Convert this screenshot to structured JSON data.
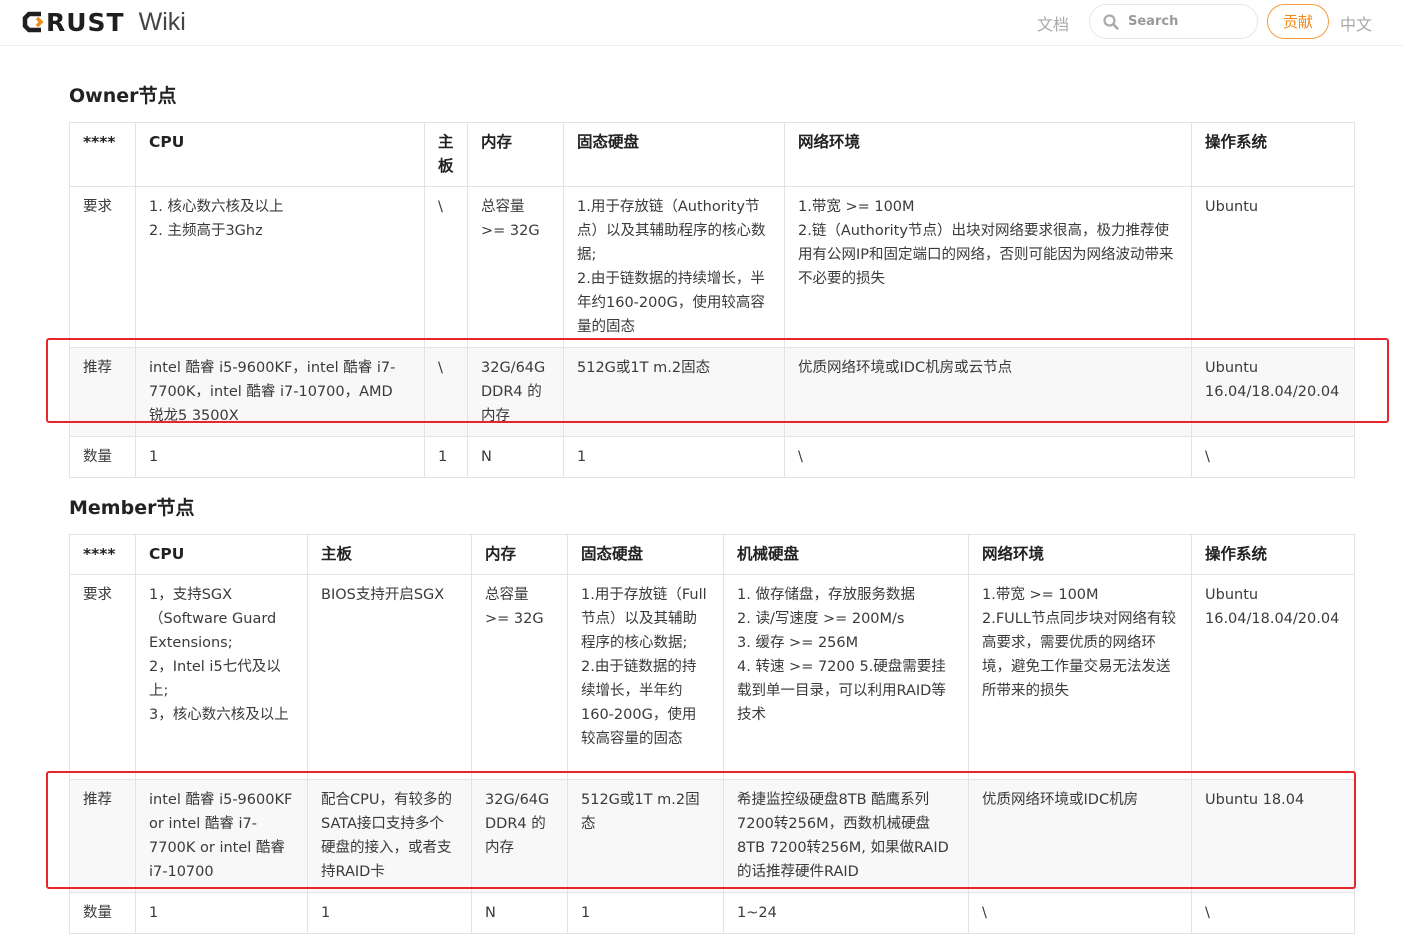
{
  "header": {
    "logo_text": "RUST",
    "logo_suffix": "Wiki",
    "nav_docs": "文档",
    "search_placeholder": "Search",
    "contribute_label": "贡献",
    "language": "中文"
  },
  "owner": {
    "title": "Owner节点",
    "headers": [
      "****",
      "CPU",
      "主板",
      "内存",
      "固态硬盘",
      "网络环境",
      "操作系统"
    ],
    "rows": [
      {
        "label": "要求",
        "cells": [
          "1. 核心数六核及以上\n2. 主频高于3Ghz",
          "\\",
          "总容量 >= 32G",
          "1.用于存放链（Authority节点）以及其辅助程序的核心数据;\n2.由于链数据的持续增长，半年约160-200G，使用较高容量的固态",
          "1.带宽 >= 100M\n2.链（Authority节点）出块对网络要求很高，极力推荐使用有公网IP和固定端口的网络，否则可能因为网络波动带来不必要的损失",
          "Ubuntu"
        ]
      },
      {
        "label": "推荐",
        "cells": [
          "intel 酷睿 i5-9600KF，intel 酷睿 i7-7700K，intel 酷睿 i7-10700，AMD 锐龙5 3500X",
          "\\",
          "32G/64G DDR4 的内存",
          "512G或1T m.2固态",
          "优质网络环境或IDC机房或云节点",
          "Ubuntu 16.04/18.04/20.04"
        ]
      },
      {
        "label": "数量",
        "cells": [
          "1",
          "1",
          "N",
          "1",
          "\\",
          "\\"
        ]
      }
    ]
  },
  "member": {
    "title": "Member节点",
    "headers": [
      "****",
      "CPU",
      "主板",
      "内存",
      "固态硬盘",
      "机械硬盘",
      "网络环境",
      "操作系统"
    ],
    "rows": [
      {
        "label": "要求",
        "cells": [
          "1，支持SGX（Software Guard Extensions;\n2，Intel i5七代及以上;\n3，核心数六核及以上",
          "BIOS支持开启SGX",
          "总容量 >= 32G",
          "1.用于存放链（Full节点）以及其辅助程序的核心数据;\n2.由于链数据的持续增长，半年约160-200G，使用较高容量的固态",
          "1. 做存储盘，存放服务数据\n2. 读/写速度 >= 200M/s\n3. 缓存 >= 256M\n4. 转速 >= 7200 5.硬盘需要挂载到单一目录，可以利用RAID等技术",
          "1.带宽 >= 100M\n2.FULL节点同步块对网络有较高要求，需要优质的网络环境，避免工作量交易无法发送所带来的损失",
          "Ubuntu 16.04/18.04/20.04"
        ]
      },
      {
        "label": "推荐",
        "cells": [
          "intel 酷睿 i5-9600KF or intel 酷睿 i7-7700K or intel 酷睿 i7-10700",
          "配合CPU，有较多的SATA接口支持多个硬盘的接入，或者支持RAID卡",
          "32G/64G DDR4 的内存",
          "512G或1T m.2固态",
          "希捷监控级硬盘8TB 酷鹰系列7200转256M，西数机械硬盘8TB 7200转256M, 如果做RAID的话推荐硬件RAID",
          "优质网络环境或IDC机房",
          "Ubuntu 18.04"
        ]
      },
      {
        "label": "数量",
        "cells": [
          "1",
          "1",
          "N",
          "1",
          "1~24",
          "\\",
          "\\"
        ]
      }
    ]
  },
  "colors": {
    "accent": "#f08a1a",
    "highlight": "#e5262b",
    "border": "#e3e3e3"
  }
}
